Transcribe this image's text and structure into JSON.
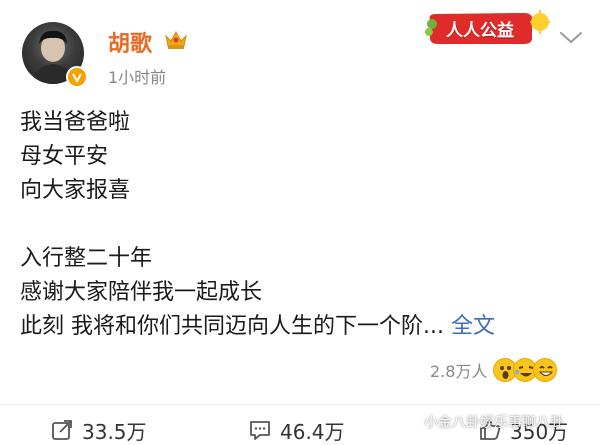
{
  "header": {
    "username": "胡歌",
    "time": "1小时前",
    "badge_label": "人人公益"
  },
  "post": {
    "lines": [
      "我当爸爸啦",
      "母女平安",
      "向大家报喜",
      "",
      "入行整二十年",
      "感谢大家陪伴我一起成长",
      "此刻 我将和你们共同迈向人生的下一个阶..."
    ],
    "full_text_link": "全文"
  },
  "reactions": {
    "count": "2.8万人"
  },
  "actions": {
    "share": "33.5万",
    "comment": "46.4万",
    "like": "350万"
  },
  "watermark": "小金八卦娱乐事聊八卦",
  "colors": {
    "username": "#e86a24",
    "link": "#3a6fb0",
    "secondary_text": "#888888"
  }
}
